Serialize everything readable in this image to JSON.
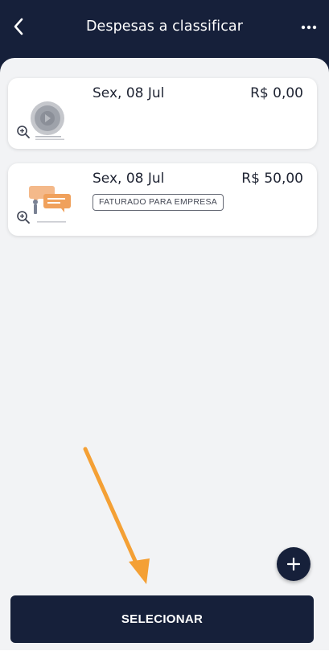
{
  "header": {
    "title": "Despesas a classificar"
  },
  "expenses": [
    {
      "date": "Sex, 08 Jul",
      "amount": "R$ 0,00",
      "badge": ""
    },
    {
      "date": "Sex, 08 Jul",
      "amount": "R$ 50,00",
      "badge": "FATURADO PARA EMPRESA"
    }
  ],
  "actions": {
    "select_label": "SELECIONAR"
  },
  "icons": {
    "back": "chevron-left-icon",
    "more": "more-horizontal-icon",
    "zoom": "zoom-in-icon",
    "add": "plus-icon"
  },
  "colors": {
    "primary": "#16203a",
    "background": "#f2f3f5",
    "annotation_arrow": "#f4a035"
  }
}
